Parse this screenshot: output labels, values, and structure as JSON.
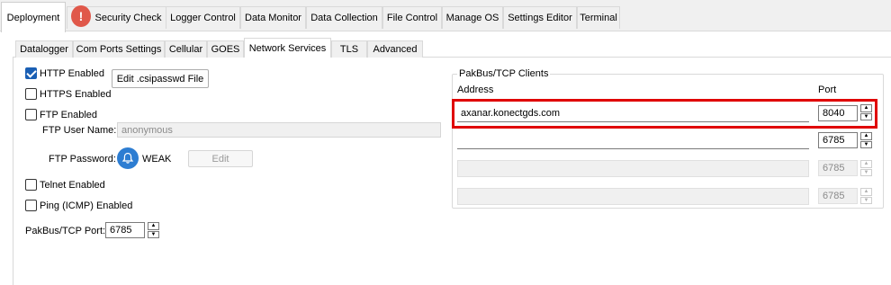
{
  "main_tabs": [
    "Deployment",
    "Security Check",
    "Logger Control",
    "Data Monitor",
    "Data Collection",
    "File Control",
    "Manage OS",
    "Settings Editor",
    "Terminal"
  ],
  "alert_icon": "!",
  "sub_tabs": [
    "Datalogger",
    "Com Ports Settings",
    "Cellular",
    "GOES",
    "Network Services",
    "TLS",
    "Advanced"
  ],
  "http_enabled": {
    "label": "HTTP Enabled",
    "checked": true
  },
  "edit_csipasswd_label": "Edit .csipasswd File",
  "https_enabled": {
    "label": "HTTPS Enabled",
    "checked": false
  },
  "ftp_enabled": {
    "label": "FTP Enabled",
    "checked": false
  },
  "ftp_user_label": "FTP User Name:",
  "ftp_user_value": "anonymous",
  "ftp_password_label": "FTP Password:",
  "password_strength": "WEAK",
  "edit_label": "Edit",
  "telnet_enabled": {
    "label": "Telnet Enabled",
    "checked": false
  },
  "ping_enabled": {
    "label": "Ping (ICMP) Enabled",
    "checked": false
  },
  "pakbus_port_label": "PakBus/TCP Port:",
  "pakbus_port_value": "6785",
  "clients": {
    "title": "PakBus/TCP Clients",
    "address_header": "Address",
    "port_header": "Port",
    "rows": [
      {
        "address": "axanar.konectgds.com",
        "port": "8040"
      },
      {
        "address": "",
        "port": "6785"
      },
      {
        "address": "",
        "port": "6785"
      },
      {
        "address": "",
        "port": "6785"
      }
    ]
  },
  "colors": {
    "highlight": "#e00000",
    "checkbox_accent": "#1a5fb4",
    "alert": "#e0584a",
    "bell": "#2d7dd2"
  }
}
